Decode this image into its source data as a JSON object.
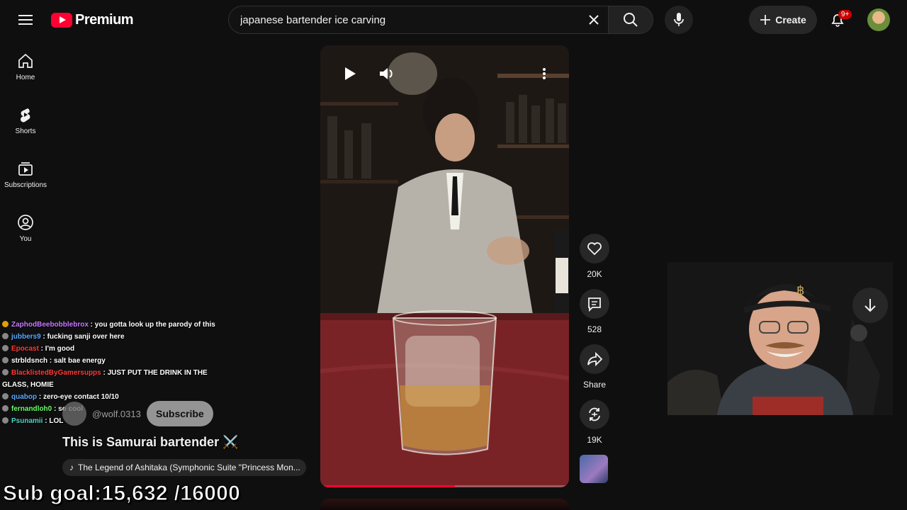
{
  "header": {
    "logo_text": "Premium",
    "search_value": "japanese bartender ice carving",
    "create_label": "Create",
    "notification_count": "9+"
  },
  "sidebar": {
    "items": [
      {
        "label": "Home",
        "icon": "home-icon"
      },
      {
        "label": "Shorts",
        "icon": "shorts-icon"
      },
      {
        "label": "Subscriptions",
        "icon": "subscriptions-icon"
      },
      {
        "label": "You",
        "icon": "you-icon"
      }
    ]
  },
  "short": {
    "progress_fraction": 0.54,
    "channel_name": "@wolf.0313",
    "subscribe_label": "Subscribe",
    "title": "This is Samurai bartender ⚔️",
    "music": "The Legend of Ashitaka (Symphonic Suite \"Princess Mon..."
  },
  "actions": {
    "likes": "20K",
    "comments": "528",
    "share": "Share",
    "remixes": "19K"
  },
  "chat": {
    "lines": [
      {
        "user": "ZaphodBeebobblebrox",
        "color": "#c678ff",
        "message": "you gotta look up the parody of this"
      },
      {
        "user": "jubbers9",
        "color": "#5aa9ff",
        "message": "fucking sanji over here"
      },
      {
        "user": "Epocast",
        "color": "#ff3b3b",
        "message": "I'm good"
      },
      {
        "user": "strbldsnch",
        "color": "#ffffff",
        "message": "salt bae energy"
      },
      {
        "user": "BlacklistedByGamersupps",
        "color": "#ff3b3b",
        "message": "JUST PUT THE DRINK IN THE GLASS, HOMIE"
      },
      {
        "user": "quabop",
        "color": "#5aa9ff",
        "message": "zero-eye contact 10/10"
      },
      {
        "user": "fernandloh0",
        "color": "#6bff6b",
        "message": "so cool"
      },
      {
        "user": "Psunamii",
        "color": "#4fd6c8",
        "message": "LOL"
      }
    ]
  },
  "overlay": {
    "subgoal_label": "Sub goal:",
    "subgoal_value": "15,632 /16000"
  }
}
